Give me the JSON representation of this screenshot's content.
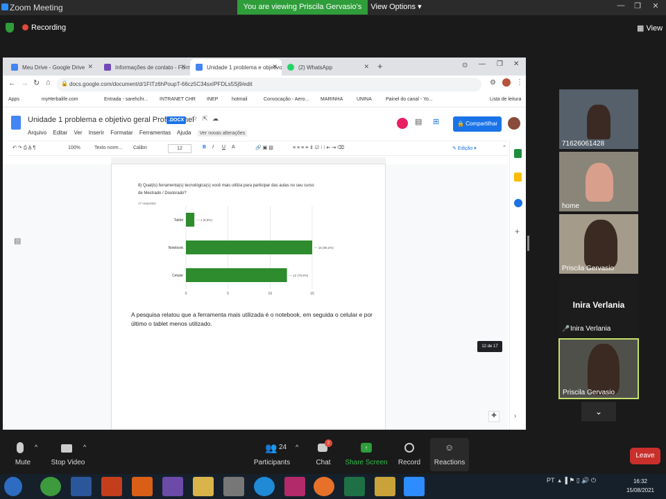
{
  "zoom": {
    "window_title": "Zoom Meeting",
    "viewing_banner": "You are viewing Priscila Gervasio's screen",
    "view_options": "View Options",
    "recording": "Recording",
    "view_label": "View"
  },
  "browser": {
    "tabs": [
      {
        "label": "Meu Drive - Google Drive",
        "color": "#4285f4"
      },
      {
        "label": "Informações de contato - Formul",
        "color": "#7248b9"
      },
      {
        "label": "Unidade 1 problema e objetivo g",
        "color": "#4285f4"
      },
      {
        "label": "(2) WhatsApp",
        "color": "#25d366"
      }
    ],
    "url": "docs.google.com/document/d/1FtTz6hPoupT-66cz5C34sxIPFDLs5Sj9/edit",
    "bookmarks": [
      "Apps",
      "myHerbalife.com",
      "Entrada - sarehchr...",
      "INTRANET CHR",
      "INEP",
      "hotmail",
      "Convocação - Aero...",
      "MARINHA",
      "UNINA",
      "Painel do canal - Yo...",
      "Lista de leitura"
    ]
  },
  "doc": {
    "title": "Unidade 1 problema e objetivo geral Prof Diosnel",
    "badge": ".DOCX",
    "menu": [
      "Arquivo",
      "Editar",
      "Ver",
      "Inserir",
      "Formatar",
      "Ferramentas",
      "Ajuda"
    ],
    "new_changes": "Ver novas alterações",
    "share": "Compartilhar",
    "toolbar": {
      "zoom": "100%",
      "style": "Texto norm...",
      "font": "Calibri",
      "size": "12",
      "mode": "Edição"
    },
    "question": "8) Qual(is) ferramenta(s) tecnológica(s) você mais utiliza para participar das aulas no seu curso de Mestrado / Doutorado?",
    "responses": "17 respostas",
    "paragraph": "A pesquisa relatou que a ferramenta mais utilizada é o notebook, em seguida o celular e por último o tablet menos utilizado.",
    "page_indicator": "12 de 17"
  },
  "chart_data": {
    "type": "bar",
    "orientation": "horizontal",
    "categories": [
      "Tablet",
      "Notebook",
      "Celular"
    ],
    "values": [
      1,
      15,
      12
    ],
    "data_labels": [
      "1 (5,9%)",
      "15 (88,2%)",
      "12 (70,6%)"
    ],
    "xlim": [
      0,
      15
    ],
    "xticks": [
      "0",
      "5",
      "10",
      "15"
    ],
    "color": "#2e8b2e",
    "grid": true
  },
  "participants": [
    {
      "name": "71626061428"
    },
    {
      "name": "home"
    },
    {
      "name": "Priscila Gervasio"
    },
    {
      "name": "Inira Verlania",
      "display": "Inira Verlania"
    },
    {
      "name": "Priscila Gervasio"
    }
  ],
  "controls": {
    "mute": "Mute",
    "stop_video": "Stop Video",
    "participants": "Participants",
    "participants_count": "24",
    "chat": "Chat",
    "chat_badge": "2",
    "share_screen": "Share Screen",
    "record": "Record",
    "reactions": "Reactions",
    "leave": "Leave"
  },
  "taskbar": {
    "lang": "PT",
    "time": "16:32",
    "date": "15/08/2021"
  }
}
